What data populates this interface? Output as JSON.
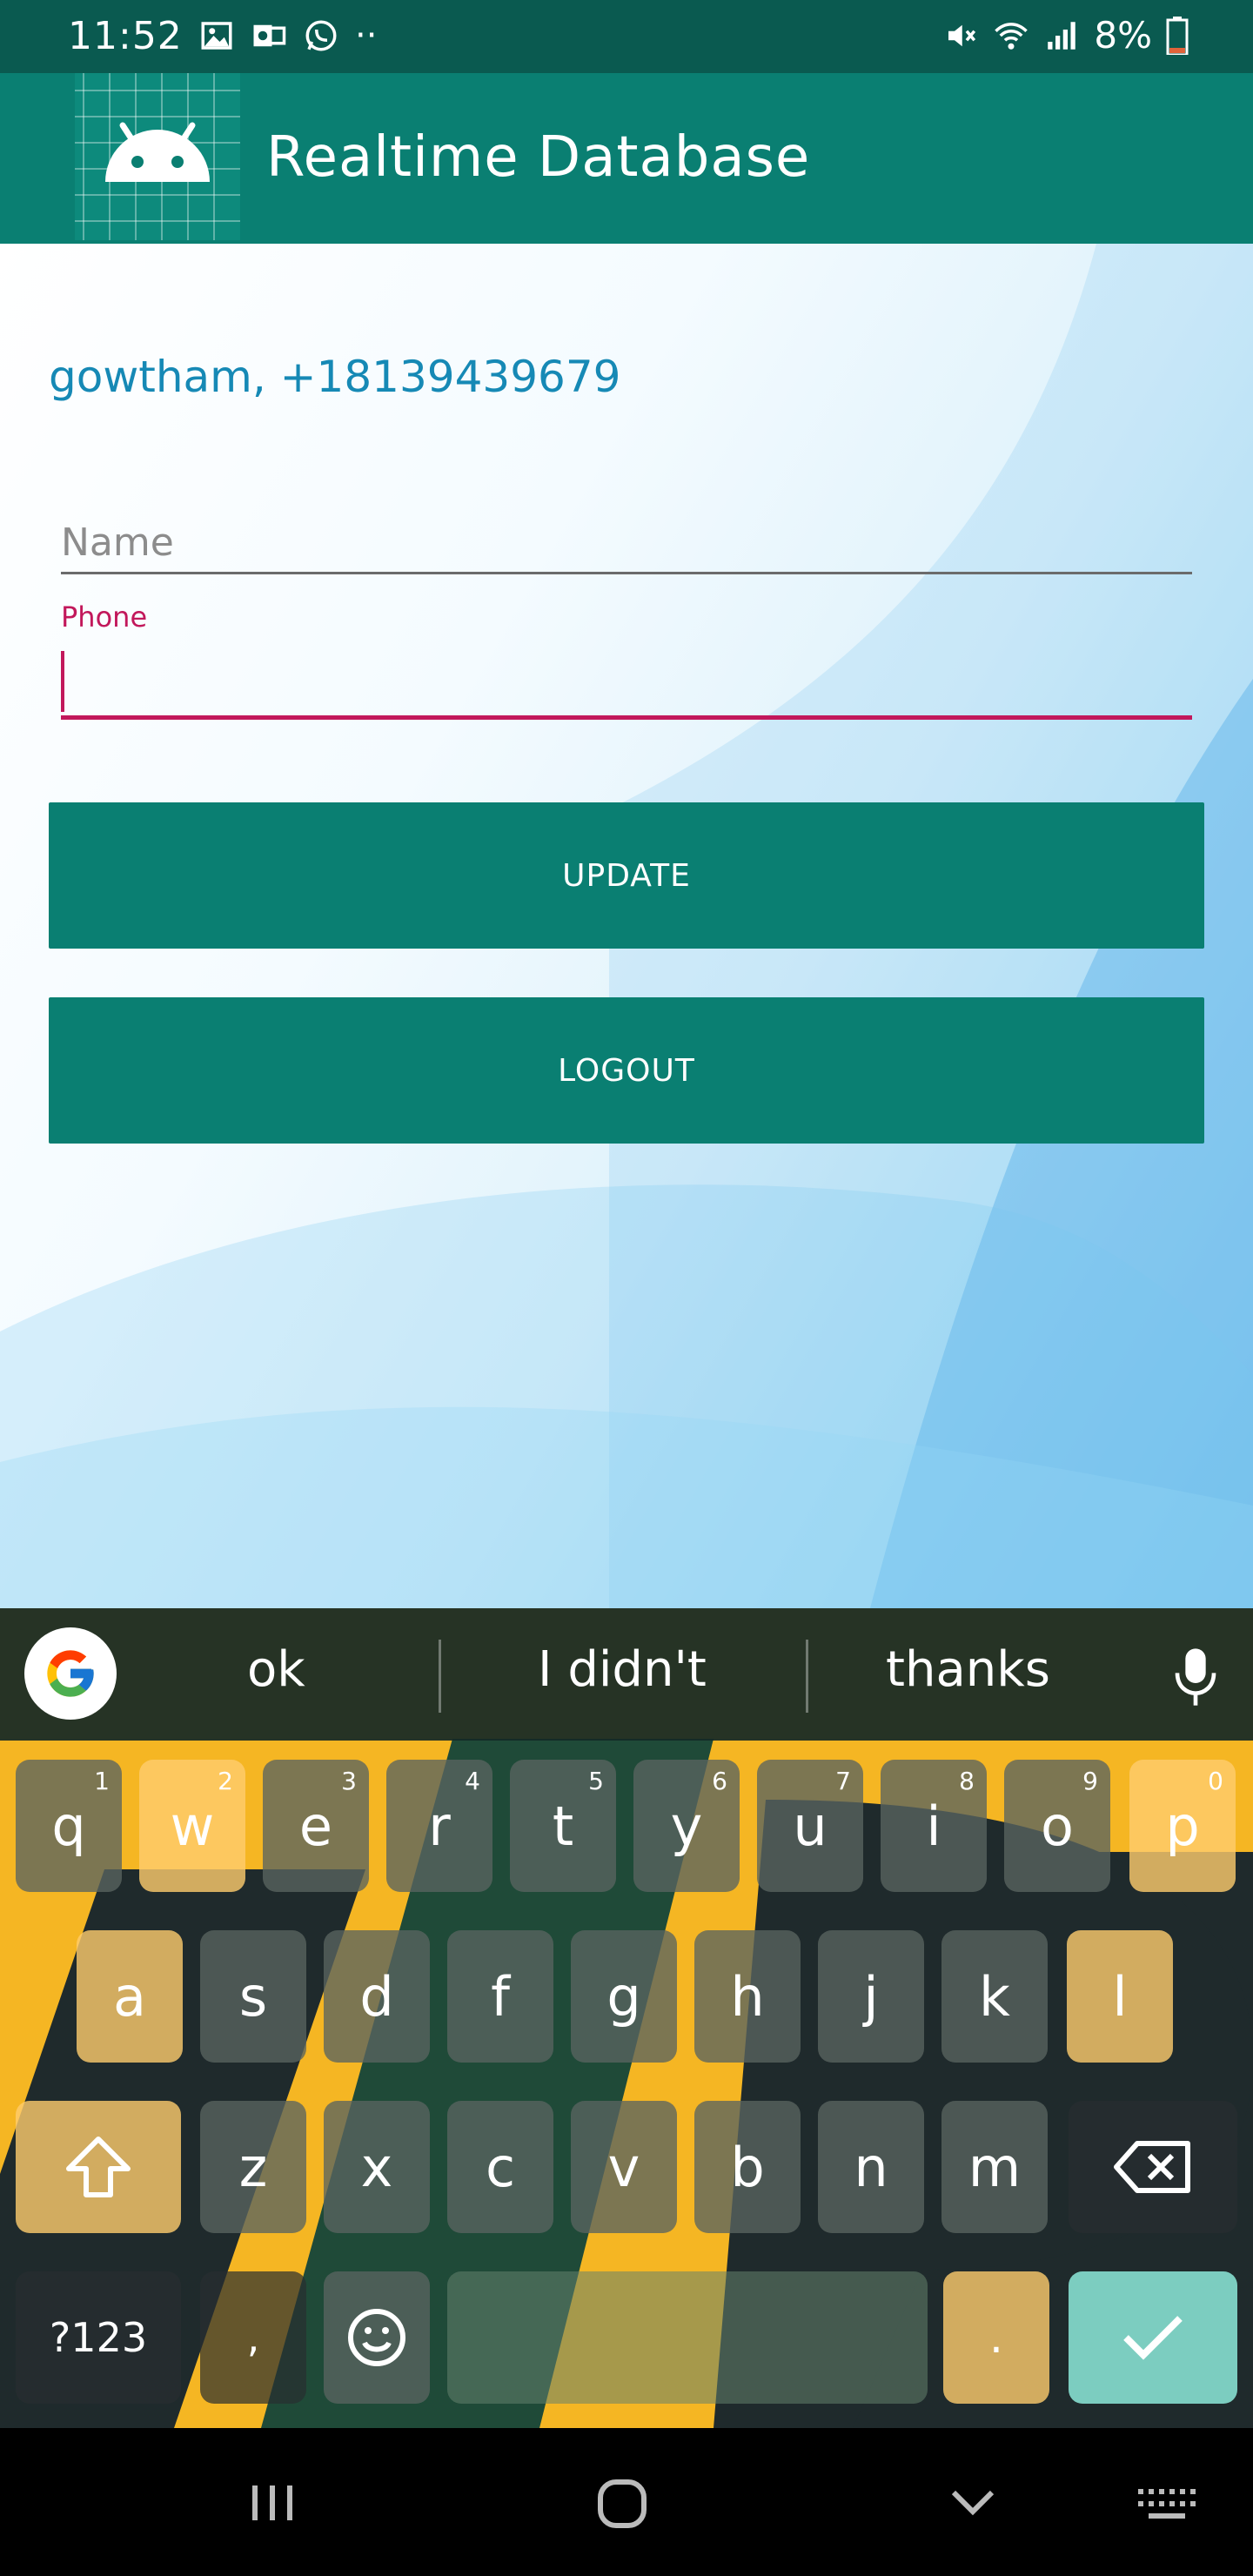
{
  "status_bar": {
    "time": "11:52",
    "battery": "8%"
  },
  "app_bar": {
    "title": "Realtime Database"
  },
  "main": {
    "user_info": "gowtham, +18139439679",
    "name_field": {
      "placeholder": "Name",
      "value": ""
    },
    "phone_field": {
      "label": "Phone",
      "value": ""
    },
    "update_button": "UPDATE",
    "logout_button": "LOGOUT"
  },
  "keyboard": {
    "suggestions": [
      "ok",
      "I didn't",
      "thanks"
    ],
    "row1": [
      {
        "k": "q",
        "h": "1"
      },
      {
        "k": "w",
        "h": "2"
      },
      {
        "k": "e",
        "h": "3"
      },
      {
        "k": "r",
        "h": "4"
      },
      {
        "k": "t",
        "h": "5"
      },
      {
        "k": "y",
        "h": "6"
      },
      {
        "k": "u",
        "h": "7"
      },
      {
        "k": "i",
        "h": "8"
      },
      {
        "k": "o",
        "h": "9"
      },
      {
        "k": "p",
        "h": "0"
      }
    ],
    "row2": [
      "a",
      "s",
      "d",
      "f",
      "g",
      "h",
      "j",
      "k",
      "l"
    ],
    "row3": [
      "z",
      "x",
      "c",
      "v",
      "b",
      "n",
      "m"
    ],
    "symbols_key": "?123",
    "comma_key": ",",
    "period_key": "."
  },
  "colors": {
    "primary": "#0a7f72",
    "status_bar": "#0a5a50",
    "accent": "#c2185b",
    "user_text": "#1689b5"
  },
  "icons": [
    "gallery-icon",
    "outlook-icon",
    "whatsapp-icon",
    "mute-icon",
    "wifi-icon",
    "signal-icon",
    "battery-icon",
    "android-logo-icon",
    "google-icon",
    "mic-icon",
    "shift-icon",
    "backspace-icon",
    "emoji-icon",
    "enter-check-icon",
    "nav-recents-icon",
    "nav-home-icon",
    "nav-back-icon",
    "keyboard-switch-icon"
  ]
}
